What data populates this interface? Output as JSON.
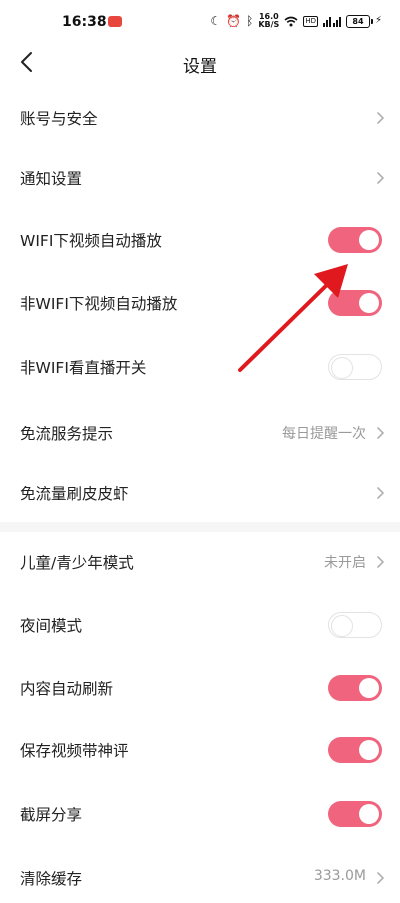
{
  "status_bar": {
    "time": "16:38",
    "net_speed_top": "16.0",
    "net_speed_bottom": "KB/S",
    "hd": "HD",
    "battery": "84"
  },
  "header": {
    "title": "设置"
  },
  "settings": [
    {
      "label": "账号与安全",
      "control": "chevron"
    },
    {
      "label": "通知设置",
      "control": "chevron"
    },
    {
      "label": "WIFI下视频自动播放",
      "control": "toggle",
      "on": true
    },
    {
      "label": "非WIFI下视频自动播放",
      "control": "toggle",
      "on": true
    },
    {
      "label": "非WIFI看直播开关",
      "control": "toggle",
      "on": false
    },
    {
      "label": "免流服务提示",
      "control": "value",
      "value": "每日提醒一次"
    },
    {
      "label": "免流量刷皮皮虾",
      "control": "chevron"
    },
    {
      "label": "儿童/青少年模式",
      "control": "value",
      "value": "未开启"
    },
    {
      "label": "夜间模式",
      "control": "toggle",
      "on": false
    },
    {
      "label": "内容自动刷新",
      "control": "toggle",
      "on": true
    },
    {
      "label": "保存视频带神评",
      "control": "toggle",
      "on": true
    },
    {
      "label": "截屏分享",
      "control": "toggle",
      "on": true
    },
    {
      "label": "清除缓存",
      "control": "value",
      "value": "333.0M"
    }
  ],
  "colors": {
    "toggle_on": "#f0647e",
    "annotation_arrow": "#e0191e"
  }
}
